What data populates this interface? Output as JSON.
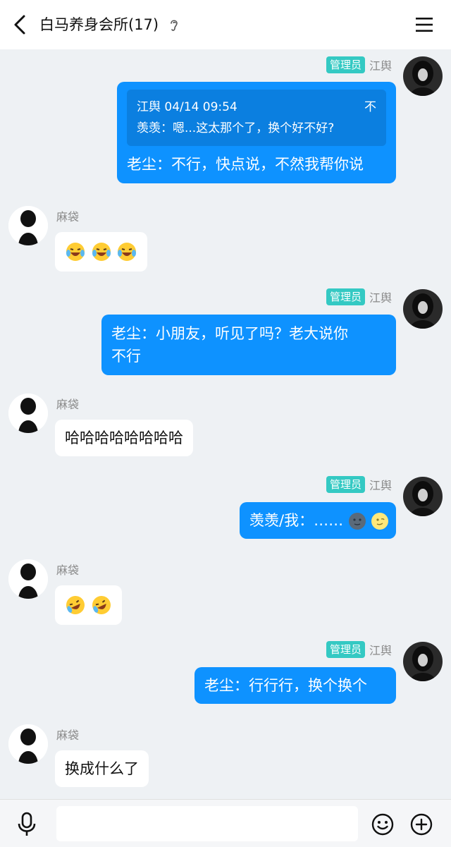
{
  "header": {
    "title": "白马养身会所(17)"
  },
  "admin_badge": "管理员",
  "admin_name": "江舆",
  "other_name": "麻袋",
  "messages": {
    "m1": {
      "quote_name": "江舆 04/14 09:54",
      "quote_close": "不",
      "quote_text": "羡羡：嗯...这太那个了，换个好不好?",
      "text": "老尘：不行，快点说，不然我帮你说"
    },
    "m2": {
      "emoji_count": 3
    },
    "m3": {
      "line1": "老尘：小朋友，听见了吗？老大说你",
      "line2": "不行"
    },
    "m4": {
      "text": "哈哈哈哈哈哈哈哈"
    },
    "m5": {
      "text": "羡羡/我：……"
    },
    "m6": {
      "emoji_count": 2
    },
    "m7": {
      "text": "老尘：行行行，换个换个"
    },
    "m8": {
      "text": "换成什么了"
    }
  },
  "icons": [
    "back-icon",
    "ear-icon",
    "menu-icon",
    "mic-icon",
    "smile-icon",
    "plus-icon"
  ],
  "colors": {
    "bubble": "#0e92ff",
    "badge": "#34c9c3",
    "background": "#eef1f4"
  }
}
